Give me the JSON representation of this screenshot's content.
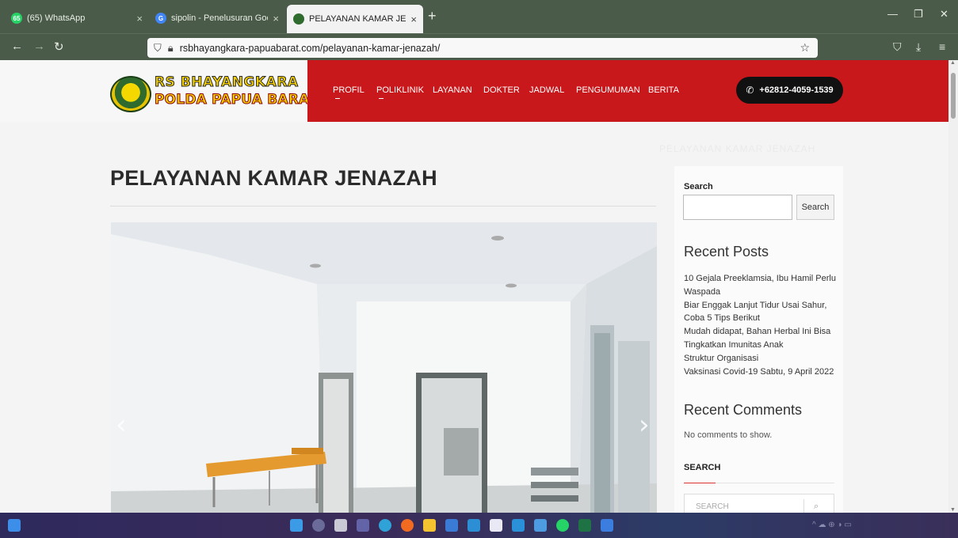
{
  "browser": {
    "tabs": [
      {
        "label": "(65) WhatsApp",
        "favicon_color": "#25d366",
        "badge": "65"
      },
      {
        "label": "sipolin - Penelusuran Google",
        "favicon_color": "#4285f4"
      },
      {
        "label": "PELAYANAN KAMAR JENAZAH",
        "favicon_color": "#2f6b2f"
      }
    ],
    "new_tab": "+",
    "close_glyph": "×",
    "url": "rsbhayangkara-papuabarat.com/pelayanan-kamar-jenazah/",
    "chrome_color": "#4a5c49"
  },
  "site": {
    "logo_line1": "RS BHAYANGKARA",
    "logo_line2": "POLDA PAPUA BARAT",
    "menu": [
      "PROFIL",
      "POLIKLINIK",
      "LAYANAN",
      "DOKTER",
      "JADWAL",
      "PENGUMUMAN",
      "BERITA"
    ],
    "phone": "+62812-4059-1539",
    "accent_color": "#c9181c",
    "faint_title": "PELAYANAN KAMAR JENAZAH"
  },
  "content": {
    "title": "PELAYANAN KAMAR JENAZAH",
    "prev_arrow": "‹",
    "next_arrow": "›"
  },
  "sidebar": {
    "search_label": "Search",
    "search_button": "Search",
    "recent_posts_heading": "Recent Posts",
    "recent_posts": [
      "10 Gejala Preeklamsia, Ibu Hamil Perlu Waspada",
      "Biar Enggak Lanjut Tidur Usai Sahur, Coba 5 Tips Berikut",
      "Mudah didapat, Bahan Herbal Ini Bisa Tingkatkan Imunitas Anak",
      "Struktur Organisasi",
      "Vaksinasi Covid-19 Sabtu, 9 April 2022"
    ],
    "recent_comments_heading": "Recent Comments",
    "no_comments": "No comments to show.",
    "search_heading": "SEARCH",
    "search_placeholder": "SEARCH"
  },
  "taskbar": {
    "icons": [
      "windows-start",
      "search",
      "task-view",
      "teams",
      "edge",
      "firefox",
      "file-explorer",
      "store",
      "vscode",
      "dropbox",
      "mail",
      "photos",
      "whatsapp",
      "excel",
      "todo"
    ]
  }
}
